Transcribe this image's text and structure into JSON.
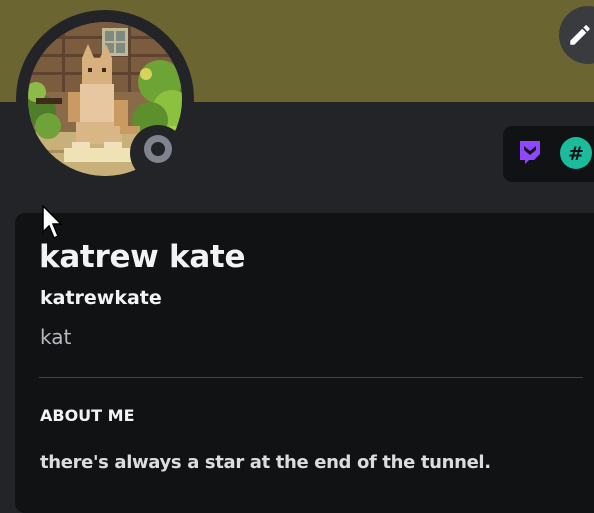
{
  "profile": {
    "display_name": "katrew kate",
    "username": "katrewkate",
    "pronouns": "kat",
    "status": "offline"
  },
  "about": {
    "heading": "ABOUT ME",
    "text": "there's always a star at the end of the tunnel."
  },
  "badges": [
    {
      "icon": "twitch-icon",
      "color": "#9146ff"
    },
    {
      "icon": "hashtag-icon",
      "color": "#1abc9c"
    }
  ],
  "colors": {
    "banner": "#6b6631",
    "background": "#232428",
    "card": "#111214",
    "status_offline": "#80848e"
  }
}
